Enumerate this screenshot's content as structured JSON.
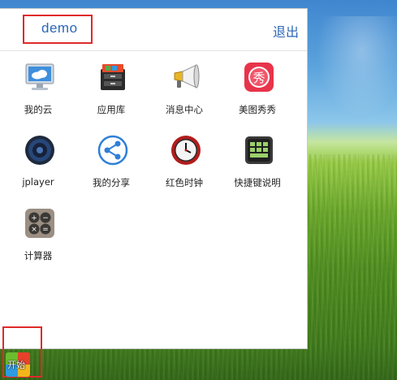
{
  "header": {
    "username": "demo",
    "logout_label": "退出"
  },
  "apps": [
    {
      "label": "我的云",
      "icon": "cloud-monitor-icon"
    },
    {
      "label": "应用库",
      "icon": "app-library-box-icon"
    },
    {
      "label": "消息中心",
      "icon": "megaphone-icon"
    },
    {
      "label": "美图秀秀",
      "icon": "meitu-xiuxiu-icon",
      "icon_text": "秀"
    },
    {
      "label": "jplayer",
      "icon": "speaker-icon"
    },
    {
      "label": "我的分享",
      "icon": "share-icon"
    },
    {
      "label": "红色时钟",
      "icon": "red-clock-icon"
    },
    {
      "label": "快捷键说明",
      "icon": "keyboard-icon"
    },
    {
      "label": "计算器",
      "icon": "calculator-icon"
    }
  ],
  "taskbar": {
    "start_label": "开始"
  },
  "colors": {
    "link_blue": "#2b66b6",
    "highlight_red": "#e02a2a"
  }
}
